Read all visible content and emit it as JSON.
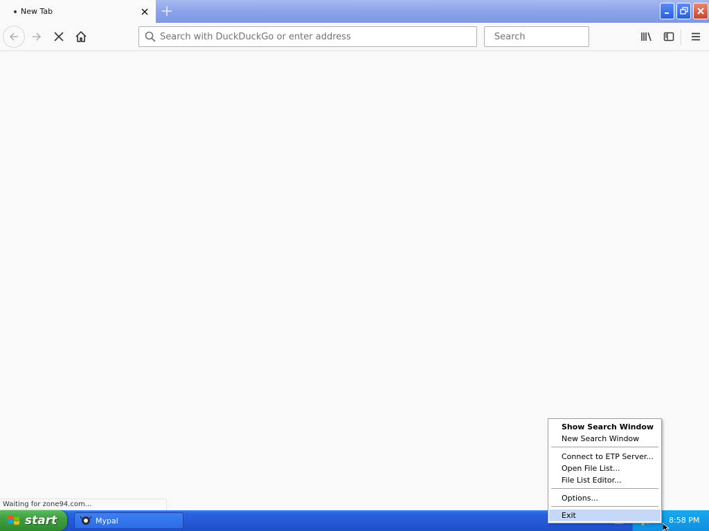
{
  "browser": {
    "tab": {
      "title": "New Tab"
    },
    "urlbar": {
      "placeholder": "Search with DuckDuckGo or enter address"
    },
    "searchbar": {
      "placeholder": "Search"
    },
    "status_text": "Waiting for zone94.com..."
  },
  "context_menu": {
    "items": [
      {
        "label": "Show Search Window",
        "bold": true
      },
      {
        "label": "New Search Window"
      },
      {
        "label": "Connect to ETP Server..."
      },
      {
        "label": "Open File List..."
      },
      {
        "label": "File List Editor..."
      },
      {
        "label": "Options..."
      },
      {
        "label": "Exit",
        "highlighted": true
      }
    ]
  },
  "taskbar": {
    "start_label": "start",
    "tasks": [
      {
        "label": "Mypal"
      }
    ],
    "clock": "8:58 PM"
  },
  "colors": {
    "taskbar_blue": "#2458d6",
    "start_green": "#3f9f3f",
    "tray_blue": "#0f8fe0",
    "menu_highlight": "#c5d8f7"
  }
}
